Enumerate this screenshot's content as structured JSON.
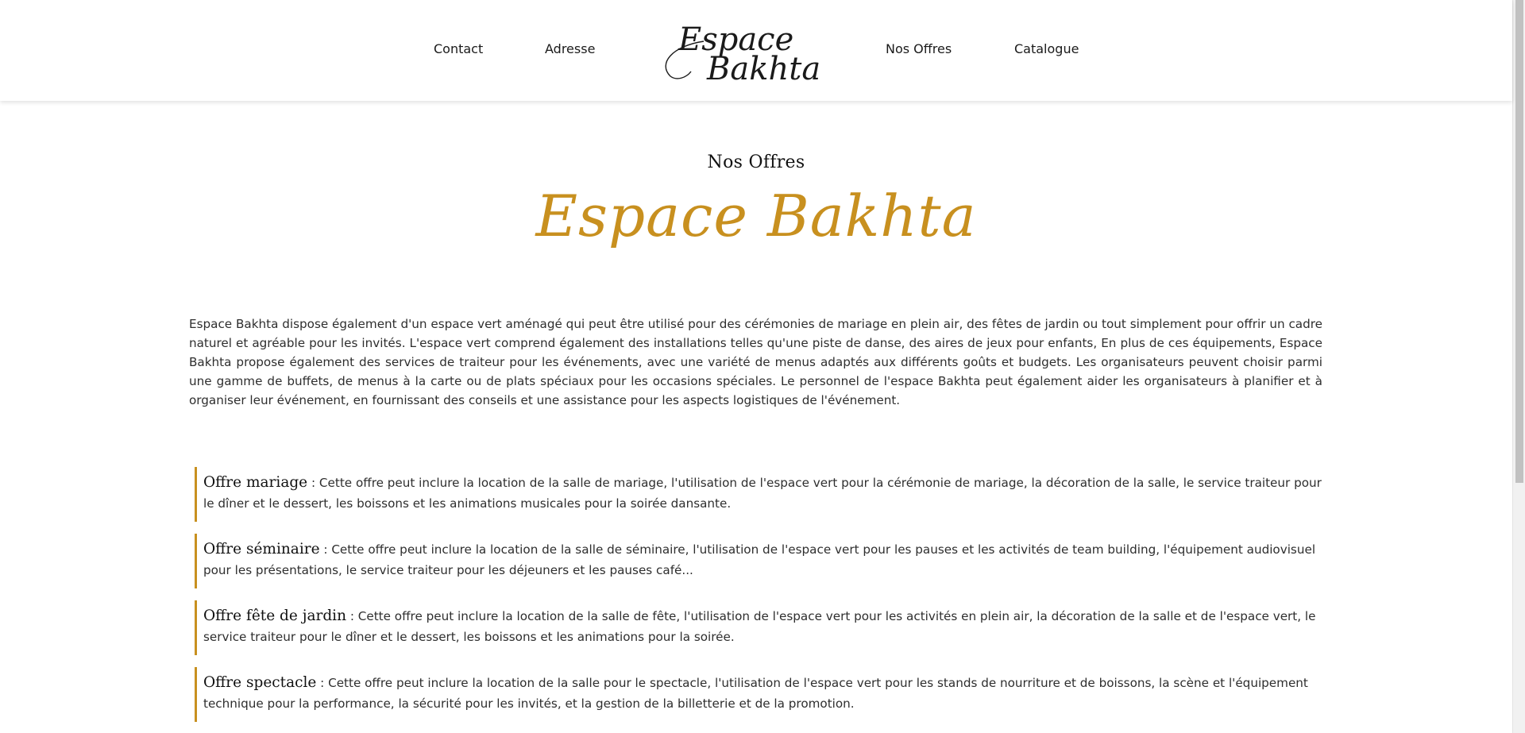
{
  "nav": {
    "contact": "Contact",
    "adresse": "Adresse",
    "nos_offres": "Nos Offres",
    "catalogue": "Catalogue"
  },
  "logo": {
    "line1": "Espace",
    "line2": "Bakhta"
  },
  "section": {
    "label": "Nos Offres",
    "brand": "Espace Bakhta"
  },
  "intro": "Espace Bakhta dispose également d'un espace vert aménagé qui peut être utilisé pour des cérémonies de mariage en plein air, des fêtes de jardin ou tout simplement pour offrir un cadre naturel et agréable pour les invités. L'espace vert comprend également des installations telles qu'une piste de danse, des aires de jeux pour enfants, En plus de ces équipements, Espace Bakhta propose également des services de traiteur pour les événements, avec une variété de menus adaptés aux différents goûts et budgets. Les organisateurs peuvent choisir parmi une gamme de buffets, de menus à la carte ou de plats spéciaux pour les occasions spéciales. Le personnel de l'espace Bakhta peut également aider les organisateurs à planifier et à organiser leur événement, en fournissant des conseils et une assistance pour les aspects logistiques de l'événement.",
  "offers": [
    {
      "title": "Offre mariage",
      "text": " : Cette offre peut inclure la location de la salle de mariage, l'utilisation de l'espace vert pour la cérémonie de mariage, la décoration de la salle, le service traiteur pour le dîner et le dessert, les boissons et les animations musicales pour la soirée dansante."
    },
    {
      "title": "Offre séminaire",
      "text": " : Cette offre peut inclure la location de la salle de séminaire, l'utilisation de l'espace vert pour les pauses et les activités de team building, l'équipement audiovisuel pour les présentations, le service traiteur pour les déjeuners et les pauses café..."
    },
    {
      "title": "Offre fête de jardin",
      "text": " : Cette offre peut inclure la location de la salle de fête, l'utilisation de l'espace vert pour les activités en plein air, la décoration de la salle et de l'espace vert, le service traiteur pour le dîner et le dessert, les boissons et les animations pour la soirée."
    },
    {
      "title": "Offre spectacle",
      "text": " : Cette offre peut inclure la location de la salle pour le spectacle, l'utilisation de l'espace vert pour les stands de nourriture et de boissons, la scène et l'équipement technique pour la performance, la sécurité pour les invités, et la gestion de la billetterie et de la promotion."
    }
  ],
  "colors": {
    "accent": "#c8901f",
    "text": "#2e2e2e"
  }
}
